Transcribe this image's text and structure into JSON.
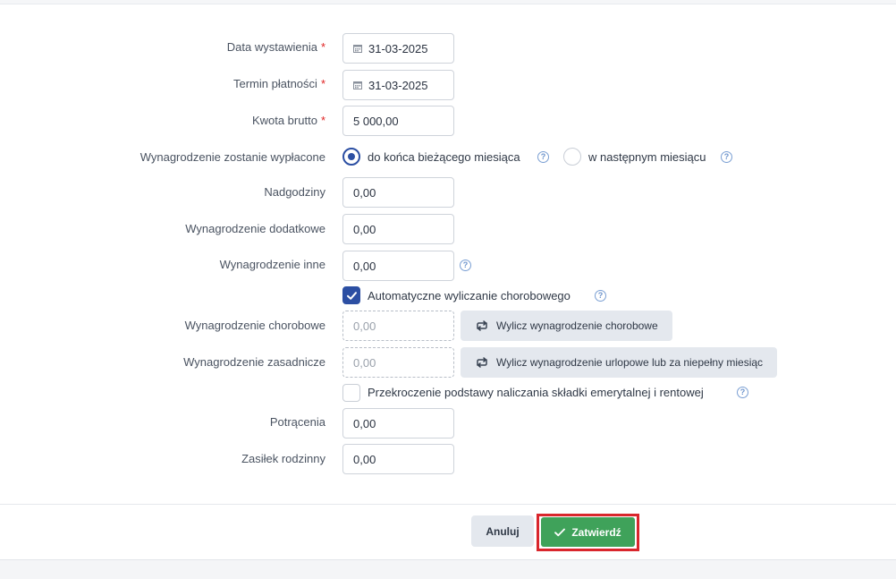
{
  "form": {
    "issue_date": {
      "label": "Data wystawienia",
      "required": "*",
      "value": "31-03-2025"
    },
    "due_date": {
      "label": "Termin płatności",
      "required": "*",
      "value": "31-03-2025"
    },
    "gross_amount": {
      "label": "Kwota brutto",
      "required": "*",
      "value": "5 000,00"
    },
    "payout": {
      "label": "Wynagrodzenie zostanie wypłacone",
      "options": [
        {
          "label": "do końca bieżącego miesiąca",
          "selected": true
        },
        {
          "label": "w następnym miesiącu",
          "selected": false
        }
      ]
    },
    "overtime": {
      "label": "Nadgodziny",
      "value": "0,00"
    },
    "additional": {
      "label": "Wynagrodzenie dodatkowe",
      "value": "0,00"
    },
    "other": {
      "label": "Wynagrodzenie inne",
      "value": "0,00"
    },
    "auto_sick": {
      "label": "Automatyczne wyliczanie chorobowego",
      "checked": true
    },
    "sick_pay": {
      "label": "Wynagrodzenie chorobowe",
      "placeholder": "0,00",
      "button": "Wylicz wynagrodzenie chorobowe"
    },
    "base_pay": {
      "label": "Wynagrodzenie zasadnicze",
      "placeholder": "0,00",
      "button": "Wylicz wynagrodzenie urlopowe lub za niepełny miesiąc"
    },
    "exceed_basis": {
      "label": "Przekroczenie podstawy naliczania składki emerytalnej i rentowej",
      "checked": false
    },
    "deductions": {
      "label": "Potrącenia",
      "value": "0,00"
    },
    "family_allowance": {
      "label": "Zasiłek rodzinny",
      "value": "0,00"
    }
  },
  "footer": {
    "cancel_label": "Anuluj",
    "confirm_label": "Zatwierdź"
  },
  "colors": {
    "accent": "#2c4fa3",
    "confirm": "#3fa25a",
    "required": "#e02424",
    "highlight": "#d9262c"
  },
  "icons": {
    "calendar": "calendar-icon",
    "help": "question-circle-icon",
    "recalc": "refresh-icon",
    "check": "check-icon"
  }
}
